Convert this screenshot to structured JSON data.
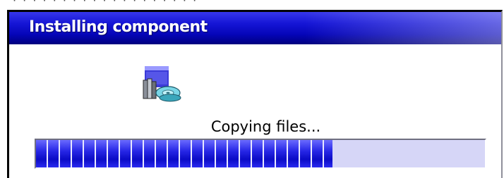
{
  "background_text": "· · · · · · · · · · · · · · · · · · ·",
  "dialog": {
    "title": "Installing component",
    "status": "Copying files...",
    "progress_percent": 66,
    "icon": "install-disk-icon"
  },
  "colors": {
    "title_bar": "#0a0ac0",
    "progress_fill": "#1414d2",
    "progress_track": "#d6d6f7",
    "segment_gap": "#e9e9ff"
  }
}
